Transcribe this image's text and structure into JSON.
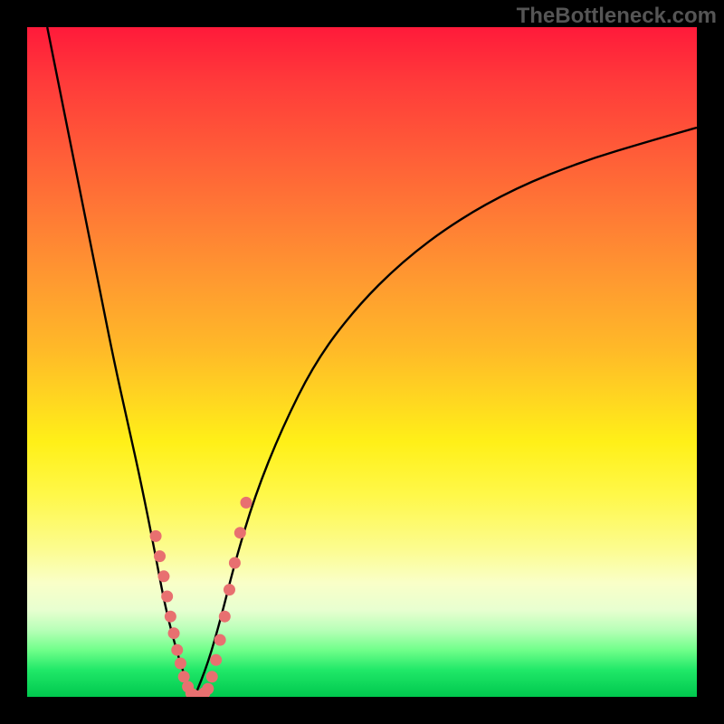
{
  "brand": "TheBottleneck.com",
  "chart_data": {
    "type": "line",
    "title": "",
    "xlabel": "",
    "ylabel": "",
    "xlim": [
      0,
      100
    ],
    "ylim": [
      0,
      100
    ],
    "grid": false,
    "legend": false,
    "note": "Inferred bottleneck-percentage curve; y is mismatch %, x is relative component performance. Values estimated from pixel positions.",
    "series": [
      {
        "name": "left-branch",
        "description": "Steep descending branch from top-left into the trough",
        "x": [
          3,
          5,
          7,
          9,
          11,
          13,
          15,
          17,
          19,
          20.5,
          22,
          23.5,
          25
        ],
        "y": [
          100,
          90,
          80,
          70,
          60,
          50,
          41,
          32,
          22,
          14,
          8,
          3,
          0
        ]
      },
      {
        "name": "right-branch",
        "description": "Shallow ascending branch from trough toward upper-right",
        "x": [
          25,
          27,
          29,
          31,
          34,
          38,
          43,
          49,
          56,
          64,
          73,
          83,
          93,
          100
        ],
        "y": [
          0,
          5,
          12,
          20,
          30,
          40,
          50,
          58,
          65,
          71,
          76,
          80,
          83,
          85
        ]
      },
      {
        "name": "markers-left",
        "description": "Salmon-colored sample markers along lower left branch",
        "x": [
          19.2,
          19.8,
          20.4,
          20.9,
          21.4,
          21.9,
          22.4,
          22.9,
          23.4,
          24.0
        ],
        "y": [
          24.0,
          21.0,
          18.0,
          15.0,
          12.0,
          9.5,
          7.0,
          5.0,
          3.0,
          1.5
        ]
      },
      {
        "name": "markers-trough",
        "description": "Salmon markers along flat bottom of V",
        "x": [
          24.5,
          25.0,
          25.5,
          26.0,
          26.5,
          27.0
        ],
        "y": [
          0.5,
          0.2,
          0.0,
          0.2,
          0.6,
          1.2
        ]
      },
      {
        "name": "markers-right",
        "description": "Salmon markers along lower right branch",
        "x": [
          27.6,
          28.2,
          28.8,
          29.5,
          30.2,
          31.0,
          31.8,
          32.7
        ],
        "y": [
          3.0,
          5.5,
          8.5,
          12.0,
          16.0,
          20.0,
          24.5,
          29.0
        ]
      }
    ],
    "gradient_stops": [
      {
        "pos": 0.0,
        "color": "#ff1a3a"
      },
      {
        "pos": 0.3,
        "color": "#ff8030"
      },
      {
        "pos": 0.6,
        "color": "#fff018"
      },
      {
        "pos": 0.82,
        "color": "#fcfc90"
      },
      {
        "pos": 0.92,
        "color": "#70ff8a"
      },
      {
        "pos": 1.0,
        "color": "#00c84e"
      }
    ],
    "marker_color": "#e87070",
    "curve_color": "#000000"
  }
}
